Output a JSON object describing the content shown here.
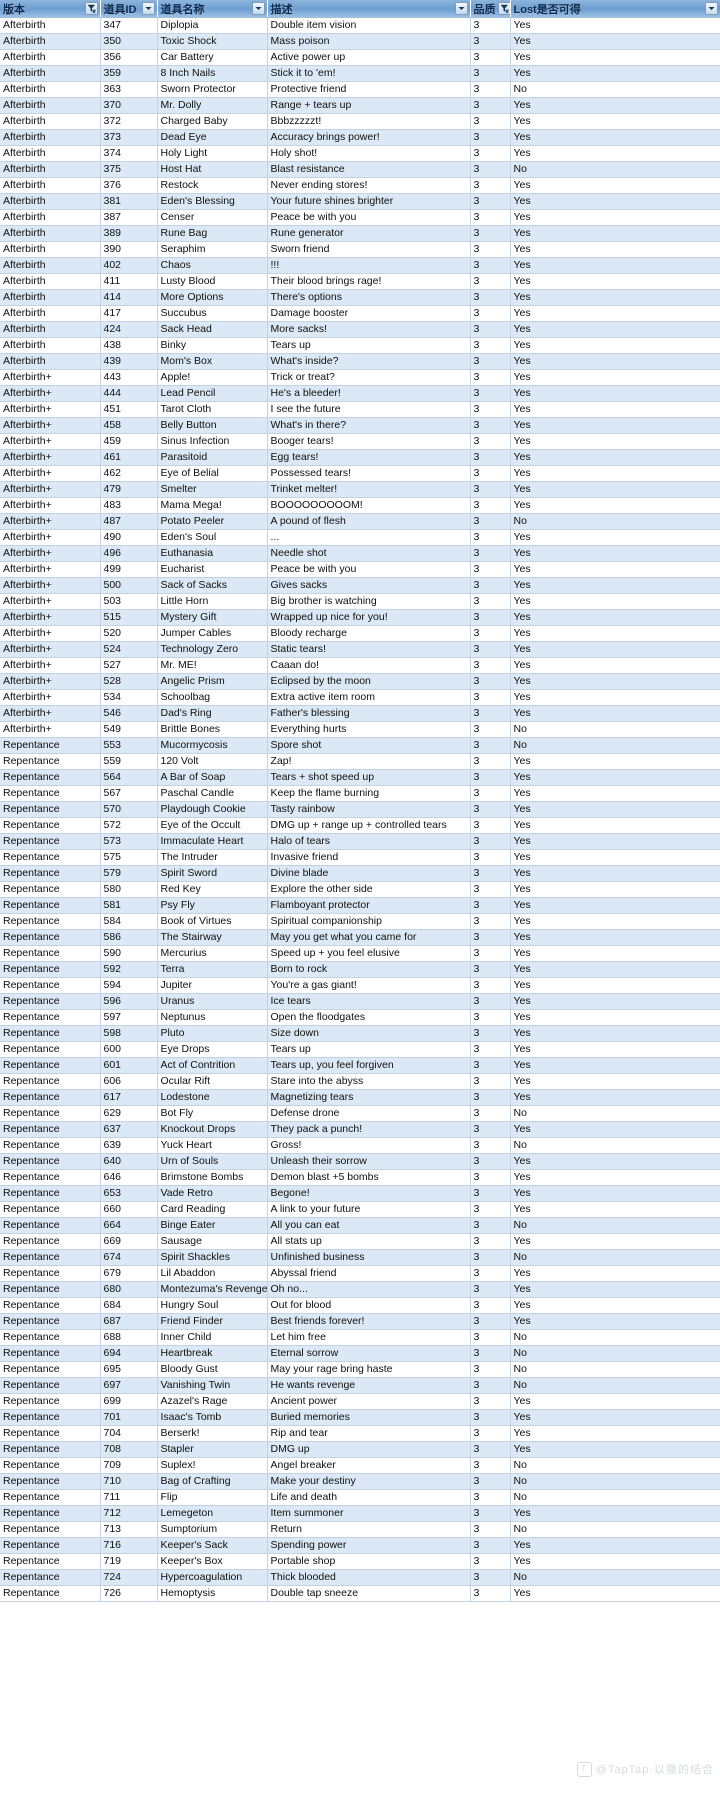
{
  "table": {
    "columns": [
      {
        "key": "version",
        "label": "版本",
        "filter_icon": "funnel-filter-icon",
        "align": "left"
      },
      {
        "key": "id",
        "label": "道具ID",
        "filter_icon": "chevron-down-icon",
        "align": "left"
      },
      {
        "key": "name",
        "label": "道具名称",
        "filter_icon": "chevron-down-icon",
        "align": "left"
      },
      {
        "key": "desc",
        "label": "描述",
        "filter_icon": "chevron-down-icon",
        "align": "left"
      },
      {
        "key": "quality",
        "label": "品质",
        "filter_icon": "funnel-filter-icon",
        "align": "left"
      },
      {
        "key": "lost",
        "label": "Lost是否可得",
        "filter_icon": "chevron-down-icon",
        "align": "left"
      }
    ],
    "rows": [
      [
        "Afterbirth",
        "347",
        "Diplopia",
        "Double item vision",
        "3",
        "Yes"
      ],
      [
        "Afterbirth",
        "350",
        "Toxic Shock",
        "Mass poison",
        "3",
        "Yes"
      ],
      [
        "Afterbirth",
        "356",
        "Car Battery",
        "Active power up",
        "3",
        "Yes"
      ],
      [
        "Afterbirth",
        "359",
        "8 Inch Nails",
        "Stick it to 'em!",
        "3",
        "Yes"
      ],
      [
        "Afterbirth",
        "363",
        "Sworn Protector",
        "Protective friend",
        "3",
        "No"
      ],
      [
        "Afterbirth",
        "370",
        "Mr. Dolly",
        "Range + tears up",
        "3",
        "Yes"
      ],
      [
        "Afterbirth",
        "372",
        "Charged Baby",
        "Bbbzzzzzt!",
        "3",
        "Yes"
      ],
      [
        "Afterbirth",
        "373",
        "Dead Eye",
        "Accuracy brings power!",
        "3",
        "Yes"
      ],
      [
        "Afterbirth",
        "374",
        "Holy Light",
        "Holy shot!",
        "3",
        "Yes"
      ],
      [
        "Afterbirth",
        "375",
        "Host Hat",
        "Blast resistance",
        "3",
        "No"
      ],
      [
        "Afterbirth",
        "376",
        "Restock",
        "Never ending stores!",
        "3",
        "Yes"
      ],
      [
        "Afterbirth",
        "381",
        "Eden's Blessing",
        "Your future shines brighter",
        "3",
        "Yes"
      ],
      [
        "Afterbirth",
        "387",
        "Censer",
        "Peace be with you",
        "3",
        "Yes"
      ],
      [
        "Afterbirth",
        "389",
        "Rune Bag",
        "Rune generator",
        "3",
        "Yes"
      ],
      [
        "Afterbirth",
        "390",
        "Seraphim",
        "Sworn friend",
        "3",
        "Yes"
      ],
      [
        "Afterbirth",
        "402",
        "Chaos",
        "!!!",
        "3",
        "Yes"
      ],
      [
        "Afterbirth",
        "411",
        "Lusty Blood",
        "Their blood brings rage!",
        "3",
        "Yes"
      ],
      [
        "Afterbirth",
        "414",
        "More Options",
        "There's options",
        "3",
        "Yes"
      ],
      [
        "Afterbirth",
        "417",
        "Succubus",
        "Damage booster",
        "3",
        "Yes"
      ],
      [
        "Afterbirth",
        "424",
        "Sack Head",
        "More sacks!",
        "3",
        "Yes"
      ],
      [
        "Afterbirth",
        "438",
        "Binky",
        "Tears up",
        "3",
        "Yes"
      ],
      [
        "Afterbirth",
        "439",
        "Mom's Box",
        "What's inside?",
        "3",
        "Yes"
      ],
      [
        "Afterbirth+",
        "443",
        "Apple!",
        "Trick or treat?",
        "3",
        "Yes"
      ],
      [
        "Afterbirth+",
        "444",
        "Lead Pencil",
        "He's a bleeder!",
        "3",
        "Yes"
      ],
      [
        "Afterbirth+",
        "451",
        "Tarot Cloth",
        "I see the future",
        "3",
        "Yes"
      ],
      [
        "Afterbirth+",
        "458",
        "Belly Button",
        "What's in there?",
        "3",
        "Yes"
      ],
      [
        "Afterbirth+",
        "459",
        "Sinus Infection",
        "Booger tears!",
        "3",
        "Yes"
      ],
      [
        "Afterbirth+",
        "461",
        "Parasitoid",
        "Egg tears!",
        "3",
        "Yes"
      ],
      [
        "Afterbirth+",
        "462",
        "Eye of Belial",
        "Possessed tears!",
        "3",
        "Yes"
      ],
      [
        "Afterbirth+",
        "479",
        "Smelter",
        "Trinket melter!",
        "3",
        "Yes"
      ],
      [
        "Afterbirth+",
        "483",
        "Mama Mega!",
        "BOOOOOOOOOM!",
        "3",
        "Yes"
      ],
      [
        "Afterbirth+",
        "487",
        "Potato Peeler",
        "A pound of flesh",
        "3",
        "No"
      ],
      [
        "Afterbirth+",
        "490",
        "Eden's Soul",
        "...",
        "3",
        "Yes"
      ],
      [
        "Afterbirth+",
        "496",
        "Euthanasia",
        "Needle shot",
        "3",
        "Yes"
      ],
      [
        "Afterbirth+",
        "499",
        "Eucharist",
        "Peace be with you",
        "3",
        "Yes"
      ],
      [
        "Afterbirth+",
        "500",
        "Sack of Sacks",
        "Gives sacks",
        "3",
        "Yes"
      ],
      [
        "Afterbirth+",
        "503",
        "Little Horn",
        "Big brother is watching",
        "3",
        "Yes"
      ],
      [
        "Afterbirth+",
        "515",
        "Mystery Gift",
        "Wrapped up nice for you!",
        "3",
        "Yes"
      ],
      [
        "Afterbirth+",
        "520",
        "Jumper Cables",
        "Bloody recharge",
        "3",
        "Yes"
      ],
      [
        "Afterbirth+",
        "524",
        "Technology Zero",
        "Static tears!",
        "3",
        "Yes"
      ],
      [
        "Afterbirth+",
        "527",
        "Mr. ME!",
        "Caaan do!",
        "3",
        "Yes"
      ],
      [
        "Afterbirth+",
        "528",
        "Angelic Prism",
        "Eclipsed by the moon",
        "3",
        "Yes"
      ],
      [
        "Afterbirth+",
        "534",
        "Schoolbag",
        "Extra active item room",
        "3",
        "Yes"
      ],
      [
        "Afterbirth+",
        "546",
        "Dad's Ring",
        "Father's blessing",
        "3",
        "Yes"
      ],
      [
        "Afterbirth+",
        "549",
        "Brittle Bones",
        "Everything hurts",
        "3",
        "No"
      ],
      [
        "Repentance",
        "553",
        "Mucormycosis",
        "Spore shot",
        "3",
        "No"
      ],
      [
        "Repentance",
        "559",
        "120 Volt",
        "Zap!",
        "3",
        "Yes"
      ],
      [
        "Repentance",
        "564",
        "A Bar of Soap",
        "Tears + shot speed up",
        "3",
        "Yes"
      ],
      [
        "Repentance",
        "567",
        "Paschal Candle",
        "Keep the flame burning",
        "3",
        "Yes"
      ],
      [
        "Repentance",
        "570",
        "Playdough Cookie",
        "Tasty rainbow",
        "3",
        "Yes"
      ],
      [
        "Repentance",
        "572",
        "Eye of the Occult",
        "DMG up + range up + controlled tears",
        "3",
        "Yes"
      ],
      [
        "Repentance",
        "573",
        "Immaculate Heart",
        "Halo of tears",
        "3",
        "Yes"
      ],
      [
        "Repentance",
        "575",
        "The Intruder",
        "Invasive friend",
        "3",
        "Yes"
      ],
      [
        "Repentance",
        "579",
        "Spirit Sword",
        "Divine blade",
        "3",
        "Yes"
      ],
      [
        "Repentance",
        "580",
        "Red Key",
        "Explore the other side",
        "3",
        "Yes"
      ],
      [
        "Repentance",
        "581",
        "Psy Fly",
        "Flamboyant protector",
        "3",
        "Yes"
      ],
      [
        "Repentance",
        "584",
        "Book of Virtues",
        "Spiritual companionship",
        "3",
        "Yes"
      ],
      [
        "Repentance",
        "586",
        "The Stairway",
        "May you get what you came for",
        "3",
        "Yes"
      ],
      [
        "Repentance",
        "590",
        "Mercurius",
        "Speed up + you feel elusive",
        "3",
        "Yes"
      ],
      [
        "Repentance",
        "592",
        "Terra",
        "Born to rock",
        "3",
        "Yes"
      ],
      [
        "Repentance",
        "594",
        "Jupiter",
        "You're a gas giant!",
        "3",
        "Yes"
      ],
      [
        "Repentance",
        "596",
        "Uranus",
        "Ice tears",
        "3",
        "Yes"
      ],
      [
        "Repentance",
        "597",
        "Neptunus",
        "Open the floodgates",
        "3",
        "Yes"
      ],
      [
        "Repentance",
        "598",
        "Pluto",
        "Size down",
        "3",
        "Yes"
      ],
      [
        "Repentance",
        "600",
        "Eye Drops",
        "Tears up",
        "3",
        "Yes"
      ],
      [
        "Repentance",
        "601",
        "Act of Contrition",
        "Tears up, you feel forgiven",
        "3",
        "Yes"
      ],
      [
        "Repentance",
        "606",
        "Ocular Rift",
        "Stare into the abyss",
        "3",
        "Yes"
      ],
      [
        "Repentance",
        "617",
        "Lodestone",
        "Magnetizing tears",
        "3",
        "Yes"
      ],
      [
        "Repentance",
        "629",
        "Bot Fly",
        "Defense drone",
        "3",
        "No"
      ],
      [
        "Repentance",
        "637",
        "Knockout Drops",
        "They pack a punch!",
        "3",
        "Yes"
      ],
      [
        "Repentance",
        "639",
        "Yuck Heart",
        "Gross!",
        "3",
        "No"
      ],
      [
        "Repentance",
        "640",
        "Urn of Souls",
        "Unleash their sorrow",
        "3",
        "Yes"
      ],
      [
        "Repentance",
        "646",
        "Brimstone Bombs",
        "Demon blast +5 bombs",
        "3",
        "Yes"
      ],
      [
        "Repentance",
        "653",
        "Vade Retro",
        "Begone!",
        "3",
        "Yes"
      ],
      [
        "Repentance",
        "660",
        "Card Reading",
        "A link to your future",
        "3",
        "Yes"
      ],
      [
        "Repentance",
        "664",
        "Binge Eater",
        "All you can eat",
        "3",
        "No"
      ],
      [
        "Repentance",
        "669",
        "Sausage",
        "All stats up",
        "3",
        "Yes"
      ],
      [
        "Repentance",
        "674",
        "Spirit Shackles",
        "Unfinished business",
        "3",
        "No"
      ],
      [
        "Repentance",
        "679",
        "Lil Abaddon",
        "Abyssal friend",
        "3",
        "Yes"
      ],
      [
        "Repentance",
        "680",
        "Montezuma's Revenge",
        "Oh no...",
        "3",
        "Yes"
      ],
      [
        "Repentance",
        "684",
        "Hungry Soul",
        "Out for blood",
        "3",
        "Yes"
      ],
      [
        "Repentance",
        "687",
        "Friend Finder",
        "Best friends forever!",
        "3",
        "Yes"
      ],
      [
        "Repentance",
        "688",
        "Inner Child",
        "Let him free",
        "3",
        "No"
      ],
      [
        "Repentance",
        "694",
        "Heartbreak",
        "Eternal sorrow",
        "3",
        "No"
      ],
      [
        "Repentance",
        "695",
        "Bloody Gust",
        "May your rage bring haste",
        "3",
        "No"
      ],
      [
        "Repentance",
        "697",
        "Vanishing Twin",
        "He wants revenge",
        "3",
        "No"
      ],
      [
        "Repentance",
        "699",
        "Azazel's Rage",
        "Ancient power",
        "3",
        "Yes"
      ],
      [
        "Repentance",
        "701",
        "Isaac's Tomb",
        "Buried memories",
        "3",
        "Yes"
      ],
      [
        "Repentance",
        "704",
        "Berserk!",
        "Rip and tear",
        "3",
        "Yes"
      ],
      [
        "Repentance",
        "708",
        "Stapler",
        "DMG up",
        "3",
        "Yes"
      ],
      [
        "Repentance",
        "709",
        "Suplex!",
        "Angel breaker",
        "3",
        "No"
      ],
      [
        "Repentance",
        "710",
        "Bag of Crafting",
        "Make your destiny",
        "3",
        "No"
      ],
      [
        "Repentance",
        "711",
        "Flip",
        "Life and death",
        "3",
        "No"
      ],
      [
        "Repentance",
        "712",
        "Lemegeton",
        "Item summoner",
        "3",
        "Yes"
      ],
      [
        "Repentance",
        "713",
        "Sumptorium",
        "Return",
        "3",
        "No"
      ],
      [
        "Repentance",
        "716",
        "Keeper's Sack",
        "Spending power",
        "3",
        "Yes"
      ],
      [
        "Repentance",
        "719",
        "Keeper's Box",
        "Portable shop",
        "3",
        "Yes"
      ],
      [
        "Repentance",
        "724",
        "Hypercoagulation",
        "Thick blooded",
        "3",
        "No"
      ],
      [
        "Repentance",
        "726",
        "Hemoptysis",
        "Double tap sneeze",
        "3",
        "Yes"
      ]
    ]
  },
  "watermark": {
    "text": "@TapTap·以撒的结合"
  },
  "colors": {
    "header_blue": "#74a3d4",
    "header_text": "#0d2b4e",
    "band_even": "#dbe8f5",
    "band_odd": "#ffffff",
    "gridline": "#c3d3e3"
  }
}
